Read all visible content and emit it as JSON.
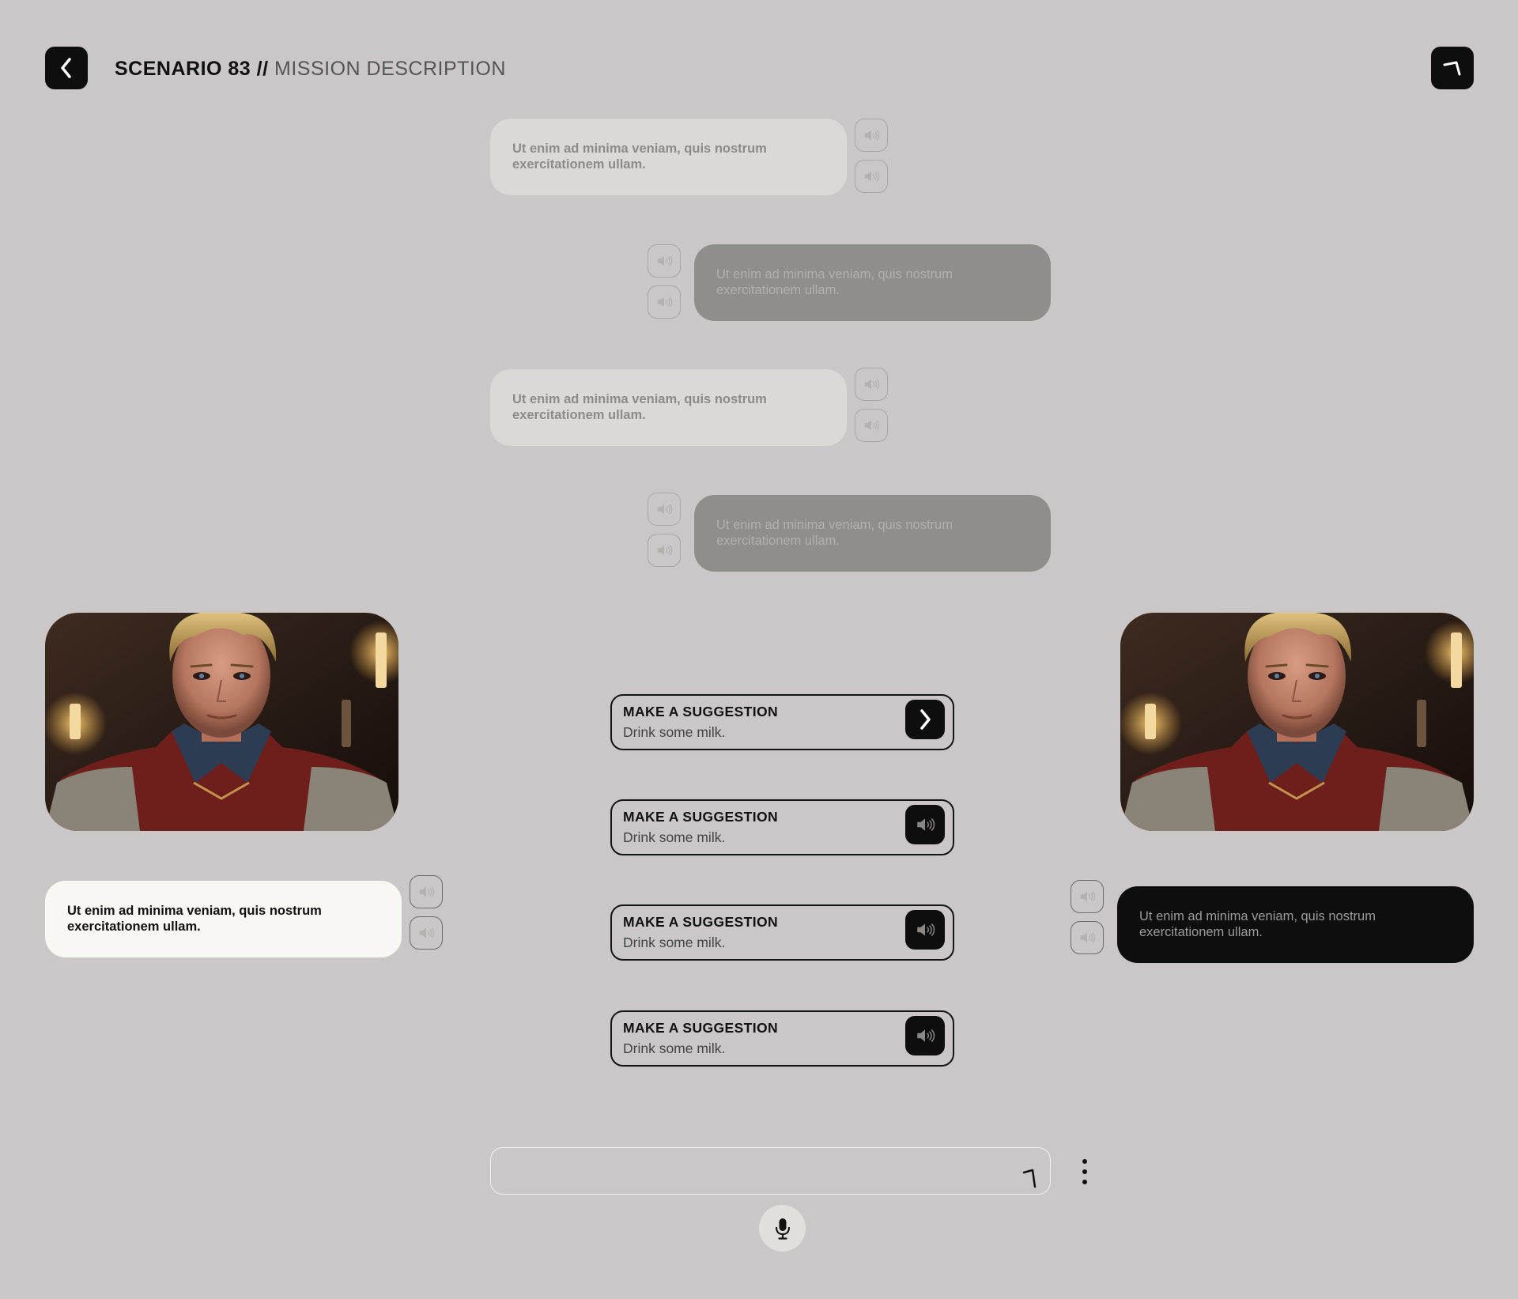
{
  "header": {
    "title_strong": "SCENARIO 83 //",
    "title_light": "MISSION DESCRIPTION",
    "back_icon": "chevron-left-icon",
    "corner_icon": "corner-arrow-icon"
  },
  "dialogue": {
    "messages": [
      {
        "text": "Ut enim ad minima veniam, quis nostrum exercitationem ullam.",
        "style": "light"
      },
      {
        "text": "Ut enim ad minima veniam, quis nostrum exercitationem ullam.",
        "style": "gray"
      },
      {
        "text": "Ut enim ad minima veniam, quis nostrum exercitationem ullam.",
        "style": "light"
      },
      {
        "text": "Ut enim ad minima veniam, quis nostrum exercitationem ullam.",
        "style": "gray"
      }
    ]
  },
  "left_character": {
    "image": "character-portrait",
    "message": "Ut enim ad minima veniam, quis nostrum exercitationem ullam."
  },
  "right_character": {
    "image": "character-portrait",
    "message": "Ut enim ad minima veniam, quis nostrum exercitationem ullam."
  },
  "suggestions": [
    {
      "heading": "MAKE A SUGGESTION",
      "text": "Drink some milk.",
      "icon": "chevron-right-icon"
    },
    {
      "heading": "MAKE A SUGGESTION",
      "text": "Drink some milk.",
      "icon": "speaker-icon"
    },
    {
      "heading": "MAKE A SUGGESTION",
      "text": "Drink some milk.",
      "icon": "speaker-icon"
    },
    {
      "heading": "MAKE A SUGGESTION",
      "text": "Drink some milk.",
      "icon": "speaker-icon"
    }
  ],
  "composer": {
    "placeholder": "",
    "send_icon": "corner-arrow-icon",
    "more_icon": "more-vertical-icon",
    "mic_icon": "microphone-icon"
  },
  "colors": {
    "background": "#cbc6c7",
    "dark": "#0e0e0e",
    "light_bubble": "#dcd8d8",
    "gray_bubble": "#908d8d",
    "white_bubble": "#f8f7f3"
  }
}
